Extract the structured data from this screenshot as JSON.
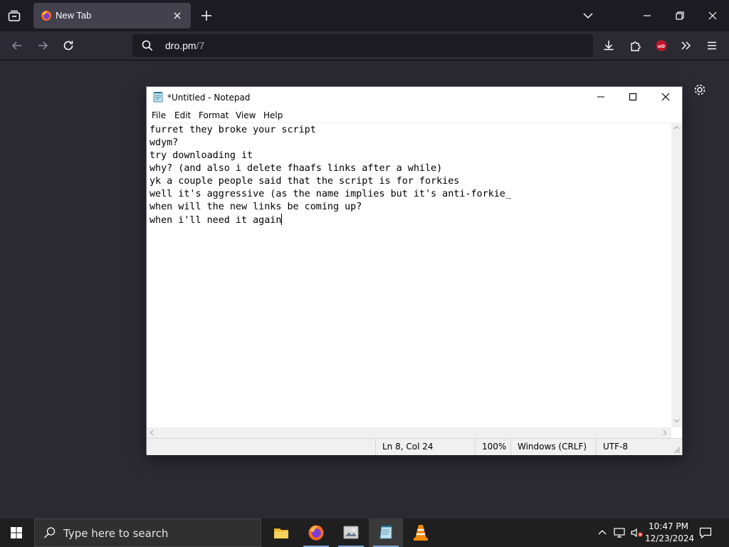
{
  "browser": {
    "tab": {
      "title": "New Tab"
    },
    "url": {
      "host": "dro.pm",
      "path": "/7"
    }
  },
  "notepad": {
    "title": "*Untitled - Notepad",
    "menu": [
      "File",
      "Edit",
      "Format",
      "View",
      "Help"
    ],
    "content": "furret they broke your script\nwdym?\ntry downloading it\nwhy? (and also i delete fhaafs links after a while)\nyk a couple people said that the script is for forkies\nwell it's aggressive (as the name implies but it's anti-forkie_\nwhen will the new links be coming up?\nwhen i'll need it again",
    "status": {
      "position": "Ln 8, Col 24",
      "zoom": "100%",
      "line_ending": "Windows (CRLF)",
      "encoding": "UTF-8"
    }
  },
  "taskbar": {
    "search_placeholder": "Type here to search",
    "apps": [
      "file-explorer",
      "firefox",
      "image-viewer",
      "notepad",
      "vlc"
    ],
    "clock": {
      "time": "10:47 PM",
      "date": "12/23/2024"
    }
  },
  "colors": {
    "browser_bg": "#2b2a33",
    "tabstrip": "#1c1b22",
    "taskbar": "#1f1f1f",
    "ublock": "#c4142b"
  }
}
